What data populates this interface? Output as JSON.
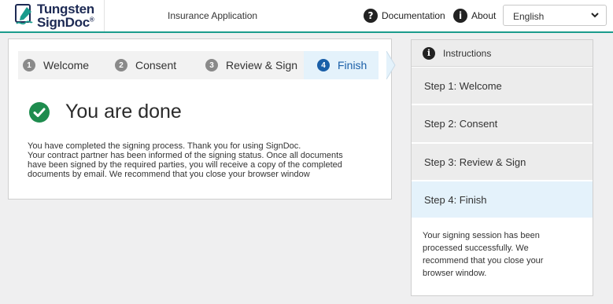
{
  "header": {
    "logo_line1": "Tungsten",
    "logo_line2": "SignDoc",
    "logo_reg": "®",
    "app_title": "Insurance Application",
    "documentation_label": "Documentation",
    "about_label": "About",
    "language_selected": "English",
    "icons": {
      "documentation": "question-circle-icon",
      "about": "info-circle-icon",
      "language": "chevron-down-icon"
    },
    "brand_color": "#1a9b8c"
  },
  "steps": [
    {
      "number": "1",
      "label": "Welcome"
    },
    {
      "number": "2",
      "label": "Consent"
    },
    {
      "number": "3",
      "label": "Review & Sign"
    },
    {
      "number": "4",
      "label": "Finish",
      "active": true
    }
  ],
  "main": {
    "title": "You are done",
    "text_lines": [
      "You have completed the signing process. Thank you for using SignDoc.",
      "Your contract partner has been informed of the signing status. Once all documents",
      "have been signed by the required parties, you will receive a copy of the completed",
      "documents by email. We recommend that you close your browser window"
    ],
    "success_color": "#1e8c4e"
  },
  "instructions": {
    "title": "Instructions",
    "items": [
      "Step 1: Welcome",
      "Step 2: Consent",
      "Step 3: Review & Sign",
      "Step 4: Finish"
    ],
    "active_index": 3,
    "message_lines": [
      "Your signing session has been",
      "processed successfully. We",
      "recommend that you close your",
      "browser window."
    ]
  }
}
